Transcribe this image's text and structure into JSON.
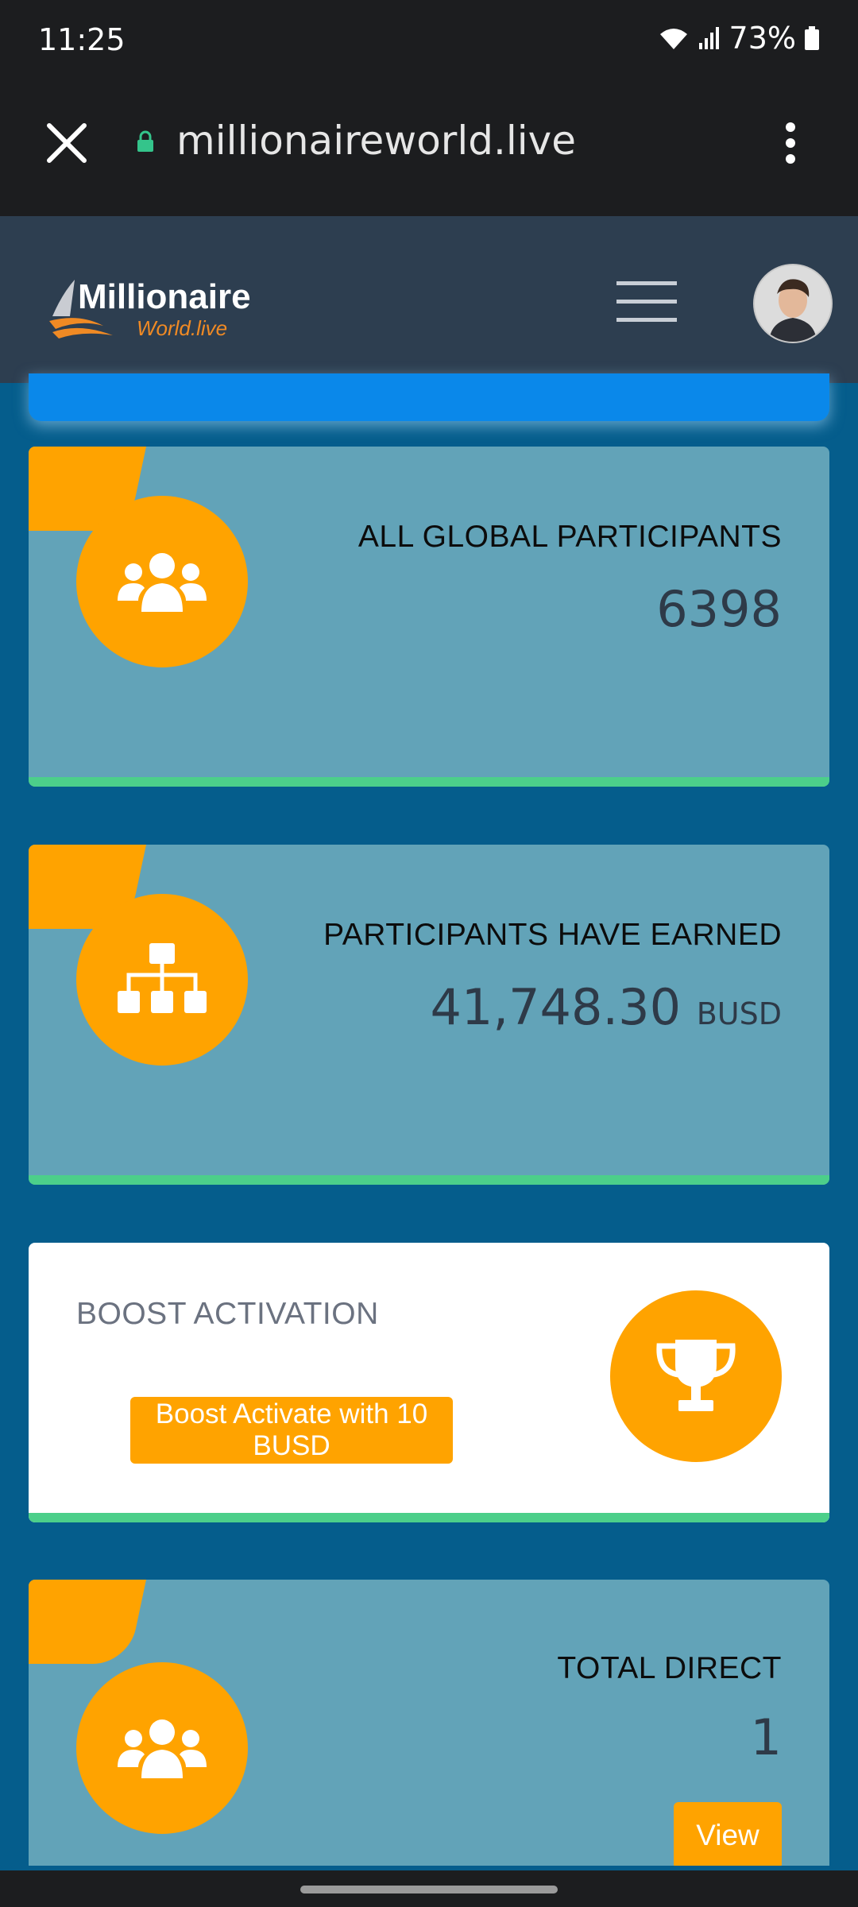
{
  "status_bar": {
    "time": "11:25",
    "battery": "73%"
  },
  "browser": {
    "url": "millionaireworld.live"
  },
  "site_header": {
    "logo_line1": "Millionaire",
    "logo_line2": "World.live"
  },
  "cards": {
    "global_participants": {
      "title": "ALL GLOBAL PARTICIPANTS",
      "value": "6398",
      "icon": "users-icon"
    },
    "participants_earned": {
      "title": "PARTICIPANTS HAVE EARNED",
      "value": "41,748.30",
      "unit": "BUSD",
      "icon": "sitemap-icon"
    },
    "boost": {
      "title": "BOOST ACTIVATION",
      "button_label": "Boost Activate with 10 BUSD",
      "icon": "trophy-icon"
    },
    "total_direct": {
      "title": "TOTAL DIRECT",
      "value": "1",
      "button_label": "View",
      "icon": "users-icon"
    }
  },
  "colors": {
    "accent": "#ffa300",
    "card": "#62a3b8",
    "background": "#055d8c",
    "header": "#2d3e50",
    "success": "#4ccf8a"
  }
}
